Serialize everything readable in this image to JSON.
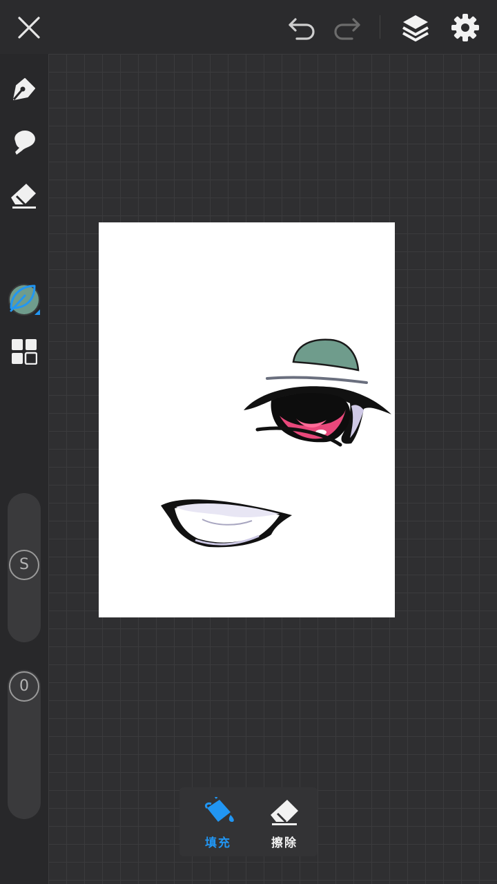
{
  "bottom_toolbar": {
    "fill_label": "填充",
    "erase_label": "擦除"
  },
  "sliders": {
    "size_label": "S",
    "opacity_label": "0"
  },
  "colors": {
    "current_color": "#6f9c8c",
    "accent": "#2196f3"
  }
}
